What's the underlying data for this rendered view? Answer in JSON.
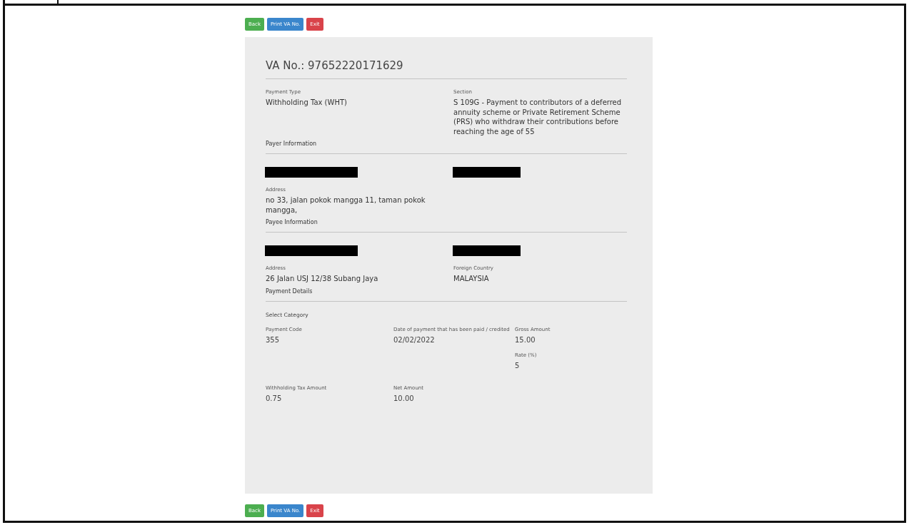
{
  "top_buttons": [
    {
      "label": "Back",
      "kind": "back"
    },
    {
      "label": "Print VA No.",
      "kind": "print"
    },
    {
      "label": "Exit",
      "kind": "exit"
    }
  ],
  "title": "VA No.: 97652220171629",
  "sections": [
    {
      "fields": [
        {
          "kind": "text",
          "label": "Payment Type",
          "value": "Withholding Tax (WHT)"
        },
        {
          "kind": "text",
          "label": "Section",
          "value": "S 109G - Payment to contributors of a deferred annuity scheme or Private Retirement Scheme (PRS) who withdraw their contributions before reaching the age of 55"
        }
      ]
    },
    {
      "heading": "Payer Information",
      "fields": [
        {
          "kind": "redacted"
        },
        {
          "kind": "redacted"
        },
        {
          "kind": "text",
          "label": "Address",
          "value": "no 33, jalan pokok mangga 11, taman pokok mangga,"
        }
      ]
    },
    {
      "heading": "Payee Information",
      "fields": [
        {
          "kind": "redacted"
        },
        {
          "kind": "redacted"
        },
        {
          "kind": "text",
          "label": "Address",
          "value": "26 Jalan USJ 12/38 Subang Jaya"
        },
        {
          "kind": "text",
          "label": "Foreign Country",
          "value": "MALAYSIA"
        }
      ]
    },
    {
      "heading": "Payment Details"
    }
  ],
  "payment": {
    "category_label": "Select Category",
    "columns": [
      [
        {
          "label": "Payment Code",
          "value": "355"
        },
        {
          "label": "Withholding Tax Amount",
          "value": "0.75"
        }
      ],
      [
        {
          "label": "Date of payment that has been paid / credited",
          "value": "02/02/2022"
        },
        {
          "label": "Net Amount",
          "value": "10.00"
        }
      ],
      [
        {
          "label": "Gross Amount",
          "value": "15.00"
        },
        {
          "label": "Rate (%)",
          "value": "5"
        }
      ]
    ]
  },
  "bottom_buttons": [
    {
      "label": "Back",
      "kind": "back"
    },
    {
      "label": "Print VA No.",
      "kind": "print"
    },
    {
      "label": "Exit",
      "kind": "exit"
    }
  ]
}
